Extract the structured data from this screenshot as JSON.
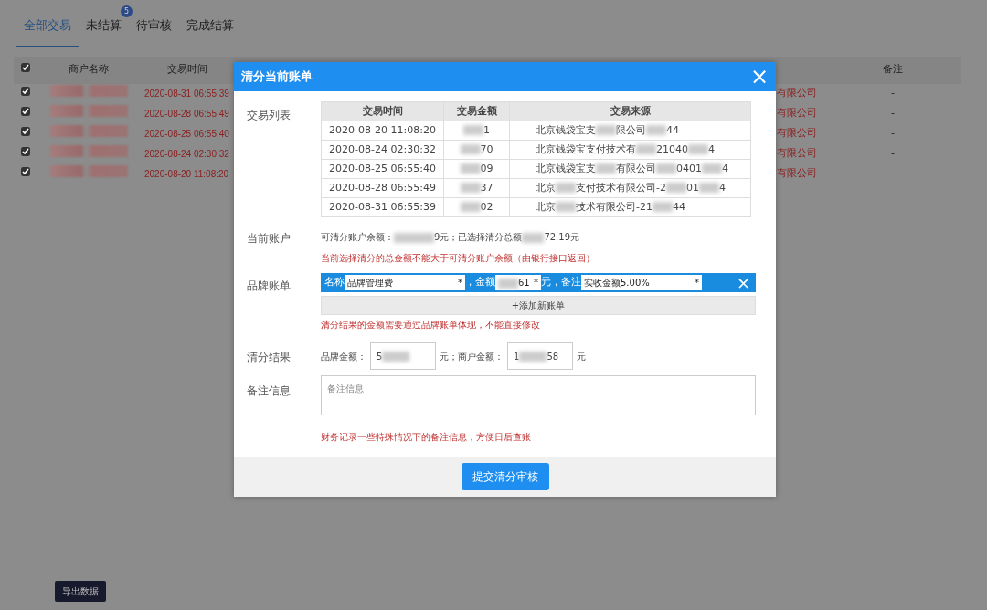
{
  "tabs": [
    {
      "label": "全部交易",
      "selected": true
    },
    {
      "label": "未结算",
      "selected": false,
      "badge": "5"
    },
    {
      "label": "待审核",
      "selected": false
    },
    {
      "label": "完成结算",
      "selected": false
    }
  ],
  "table": {
    "columns": [
      "商户名称",
      "交易时间",
      "备注"
    ],
    "rows": [
      {
        "checked": true,
        "time": "2020-08-31 06:55:39",
        "source": "有限公司",
        "note": "-"
      },
      {
        "checked": true,
        "time": "2020-08-28 06:55:49",
        "source": "有限公司",
        "note": "-"
      },
      {
        "checked": true,
        "time": "2020-08-25 06:55:40",
        "source": "有限公司",
        "note": "-"
      },
      {
        "checked": true,
        "time": "2020-08-24 02:30:32",
        "source": "有限公司",
        "note": "-"
      },
      {
        "checked": true,
        "time": "2020-08-20 11:08:20",
        "source": "有限公司",
        "note": "-"
      }
    ],
    "all_checked": true
  },
  "footer_buttons": [
    "导出数据"
  ],
  "modal": {
    "title": "清分当前账单",
    "close": "×",
    "list_label": "交易列表",
    "list_columns": [
      "交易时间",
      "交易金额",
      "交易来源"
    ],
    "list_rows": [
      {
        "time": "2020-08-20 11:08:20",
        "amount": [
          "1"
        ],
        "source": [
          "北京钱袋宝支",
          "限公司",
          "44"
        ]
      },
      {
        "time": "2020-08-24 02:30:32",
        "amount": [
          "70"
        ],
        "source": [
          "北京钱袋宝支付技术有",
          "21040",
          "4"
        ]
      },
      {
        "time": "2020-08-25 06:55:40",
        "amount": [
          "09"
        ],
        "source": [
          "北京钱袋宝支",
          "有限公司",
          "0401",
          "4"
        ]
      },
      {
        "time": "2020-08-28 06:55:49",
        "amount": [
          "37"
        ],
        "source": [
          "北京",
          "支付技术有限公司-2",
          "01",
          "4"
        ]
      },
      {
        "time": "2020-08-31 06:55:39",
        "amount": [
          "02"
        ],
        "source": [
          "北京",
          "技术有限公司-21",
          "44"
        ]
      }
    ],
    "account_label": "当前账户",
    "account_parts": [
      "可清分账户余额：",
      "9元；已选择清分总额",
      "72.19元"
    ],
    "account_hint": "当前选择清分的总金额不能大于可清分账户余额（由银行接口返回）",
    "brand_label": "品牌账单",
    "brand_bill": {
      "name_label": "名称",
      "name": "品牌管理费",
      "amount_label": "，金额",
      "amount": "61",
      "unit_label": "元，备注",
      "note": "实收金额5.00%",
      "required": "*",
      "remove": "×"
    },
    "add_bill": "+添加新账单",
    "brand_hint": "清分结果的金额需要通过品牌账单体现，不能直接修改",
    "result_label": "清分结果",
    "brand_amount_label": "品牌金额：",
    "brand_amount": "5",
    "merchant_amount_label": "元；商户金额：",
    "merchant_amount": [
      "1",
      "58"
    ],
    "unit": "元",
    "note_label": "备注信息",
    "note_placeholder": "备注信息",
    "note_hint": "财务记录一些特殊情况下的备注信息，方便日后查账",
    "submit": "提交清分审核"
  }
}
